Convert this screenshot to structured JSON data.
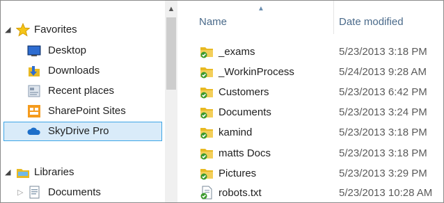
{
  "navigation": {
    "favorites": {
      "label": "Favorites"
    },
    "items": [
      {
        "label": "Desktop",
        "icon": "desktop-icon"
      },
      {
        "label": "Downloads",
        "icon": "downloads-icon"
      },
      {
        "label": "Recent places",
        "icon": "recent-places-icon"
      },
      {
        "label": "SharePoint Sites",
        "icon": "sharepoint-icon"
      },
      {
        "label": "SkyDrive Pro",
        "icon": "skydrive-icon",
        "selected": true
      }
    ],
    "libraries": {
      "label": "Libraries"
    },
    "library_items": [
      {
        "label": "Documents",
        "icon": "document-icon"
      }
    ]
  },
  "file_list": {
    "columns": {
      "name": "Name",
      "date_modified": "Date modified"
    },
    "sort": {
      "column": "Name",
      "direction": "ascending"
    },
    "rows": [
      {
        "name": "_exams",
        "date": "5/23/2013 3:18 PM",
        "type": "folder",
        "sync": "synced"
      },
      {
        "name": "_WorkinProcess",
        "date": "5/24/2013 9:28 AM",
        "type": "folder",
        "sync": "synced"
      },
      {
        "name": "Customers",
        "date": "5/23/2013 6:42 PM",
        "type": "folder",
        "sync": "synced"
      },
      {
        "name": "Documents",
        "date": "5/23/2013 3:24 PM",
        "type": "folder",
        "sync": "synced"
      },
      {
        "name": "kamind",
        "date": "5/23/2013 3:18 PM",
        "type": "folder",
        "sync": "synced"
      },
      {
        "name": "matts Docs",
        "date": "5/23/2013 3:18 PM",
        "type": "folder",
        "sync": "synced"
      },
      {
        "name": "Pictures",
        "date": "5/23/2013 3:29 PM",
        "type": "folder",
        "sync": "synced"
      },
      {
        "name": "robots.txt",
        "date": "5/23/2013 10:28 AM",
        "type": "text-file",
        "sync": "synced"
      }
    ]
  },
  "colors": {
    "selection_fill": "#d9ebf9",
    "selection_border": "#3da5e6",
    "folder": "#e8b923",
    "sync_check": "#3c9b2f",
    "header_text": "#4a6a8a"
  }
}
